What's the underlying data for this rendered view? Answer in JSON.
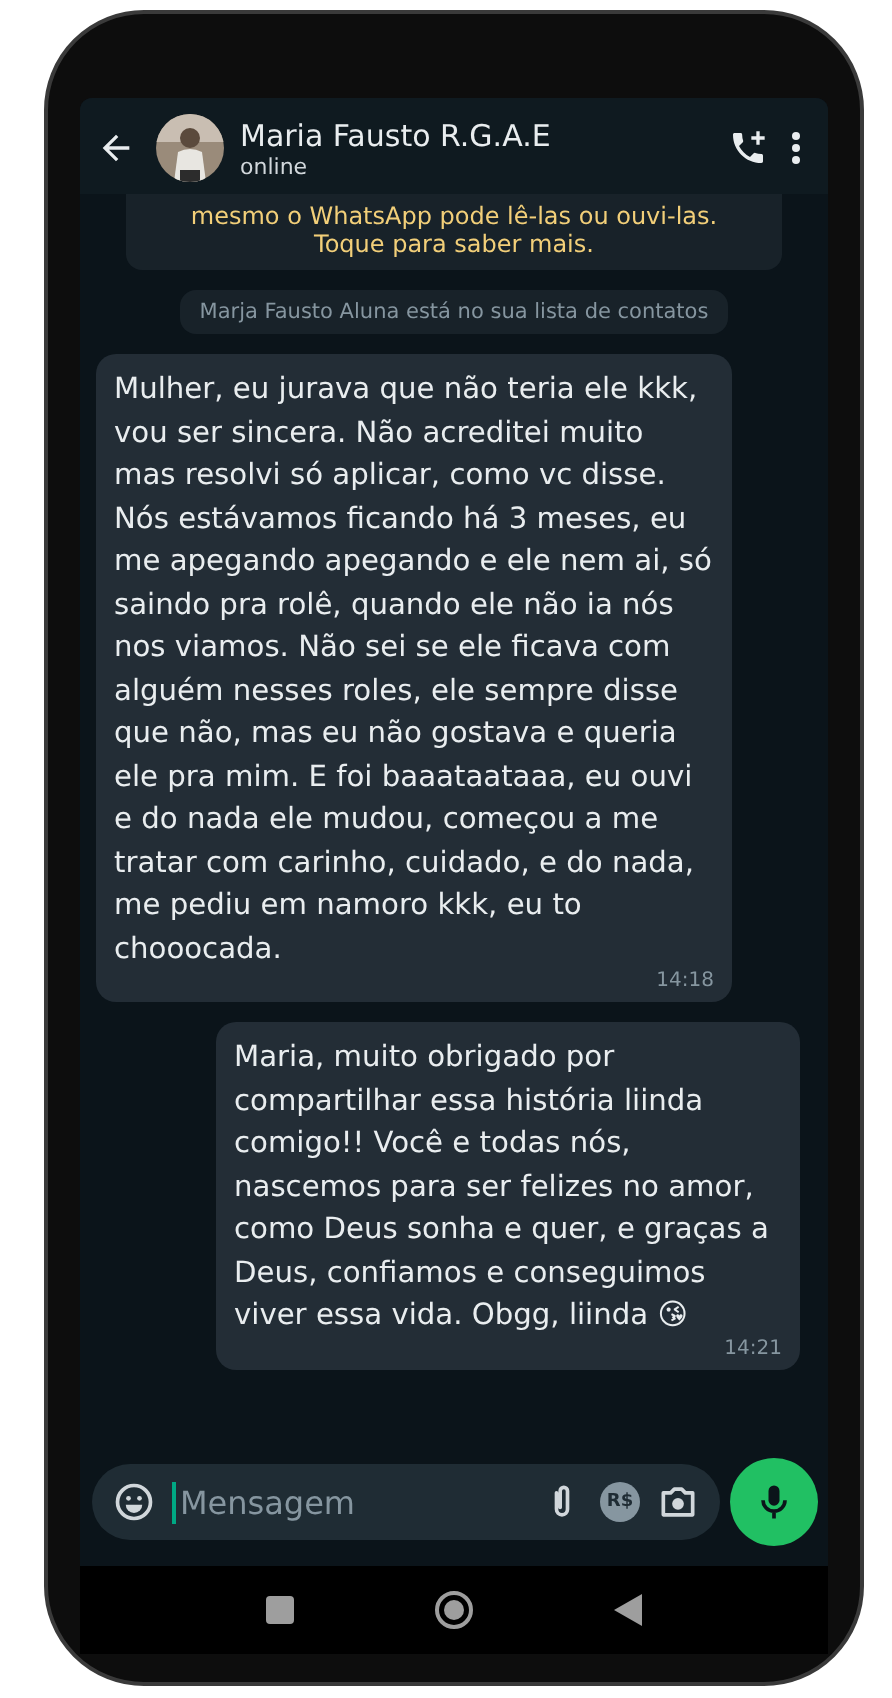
{
  "header": {
    "contact_name": "Maria Fausto R.G.A.E",
    "status": "online"
  },
  "notices": [
    {
      "kind": "encryption",
      "text": "mesmo o WhatsApp pode lê-las ou ouvi-las. Toque para saber mais."
    },
    {
      "kind": "system",
      "text": "Marja Fausto Aluna está no sua lista de contatos"
    }
  ],
  "messages": [
    {
      "kind": "incoming",
      "text": "Mulher, eu jurava que não teria ele kkk, vou ser sincera. Não acreditei muito mas resolvi só aplicar, como vc disse. Nós estávamos ficando há 3 meses, eu me apegando apegando e ele nem ai, só saindo pra rolê, quando ele não ia nós nos viamos. Não sei se ele ficava com alguém nesses roles, ele sempre disse que não, mas eu não gostava e queria ele pra mim. E foi baaataataaa, eu ouvi e do nada ele mudou, começou a me tratar com carinho, cuidado, e do nada, me pediu em namoro kkk, eu to chooocada.",
      "time": "14:18"
    },
    {
      "kind": "outgoing",
      "text": "Maria, muito obrigado por compartilhar essa história liinda comigo!! Você e todas nós, nascemos para ser felizes no amor, como Deus sonha e quer, e graças a Deus, confiamos e conseguimos viver essa vida. Obgg, liinda 😘",
      "time": "14:21"
    }
  ],
  "composer": {
    "placeholder": "Mensagem",
    "payment_label": "R$"
  }
}
